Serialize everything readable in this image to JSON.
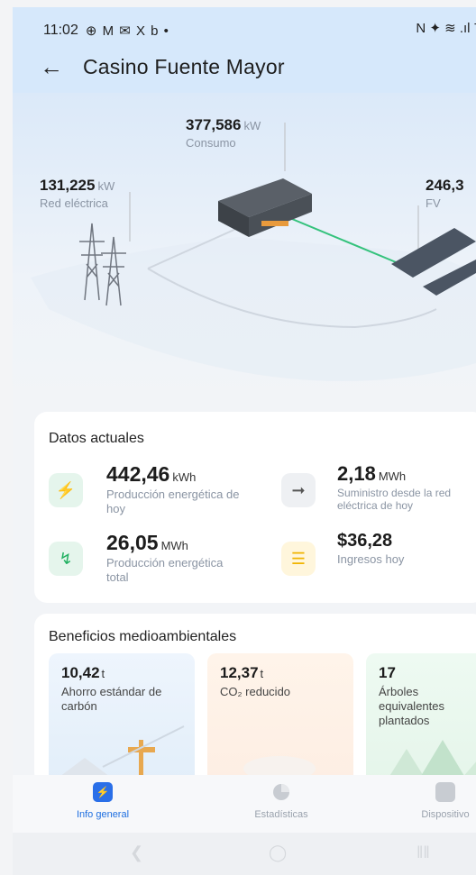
{
  "status_bar": {
    "time": "11:02",
    "left_icons": "⊕ M ✉ X b •",
    "right_icons": "N ✦ ≋ .ıl 7"
  },
  "header": {
    "title": "Casino Fuente Mayor"
  },
  "flow": {
    "consumption": {
      "value": "377,586",
      "unit": "kW",
      "label": "Consumo"
    },
    "grid": {
      "value": "131,225",
      "unit": "kW",
      "label": "Red eléctrica"
    },
    "pv": {
      "value": "246,3",
      "unit": "",
      "label": "FV"
    }
  },
  "current_data": {
    "title": "Datos actuales",
    "items": [
      {
        "value": "442,46",
        "unit": "kWh",
        "label": "Producción energética de hoy",
        "icon": "bolt-icon"
      },
      {
        "value": "2,18",
        "unit": "MWh",
        "label": "Suministro desde la red eléctrica de hoy",
        "icon": "grid-supply-icon"
      },
      {
        "value": "26,05",
        "unit": "MWh",
        "label": "Producción energética total",
        "icon": "double-bolt-icon"
      },
      {
        "value": "$36,28",
        "unit": "",
        "label": "Ingresos hoy",
        "icon": "coins-icon"
      }
    ]
  },
  "benefits": {
    "title": "Beneficios medioambientales",
    "items": [
      {
        "value": "10,42",
        "unit": "t",
        "label": "Ahorro estándar de carbón"
      },
      {
        "value": "12,37",
        "unit": "t",
        "label": "CO₂ reducido"
      },
      {
        "value": "17",
        "unit": "",
        "label": "Árboles equivalentes plantados"
      }
    ]
  },
  "bottom_nav": {
    "items": [
      {
        "label": "Info general",
        "active": true
      },
      {
        "label": "Estadísticas",
        "active": false
      },
      {
        "label": "Dispositivo",
        "active": false
      }
    ]
  },
  "colors": {
    "header_bg": "#d6e8fb",
    "active_nav": "#1f6fe0",
    "green": "#20b060",
    "yellow": "#f0b400"
  }
}
